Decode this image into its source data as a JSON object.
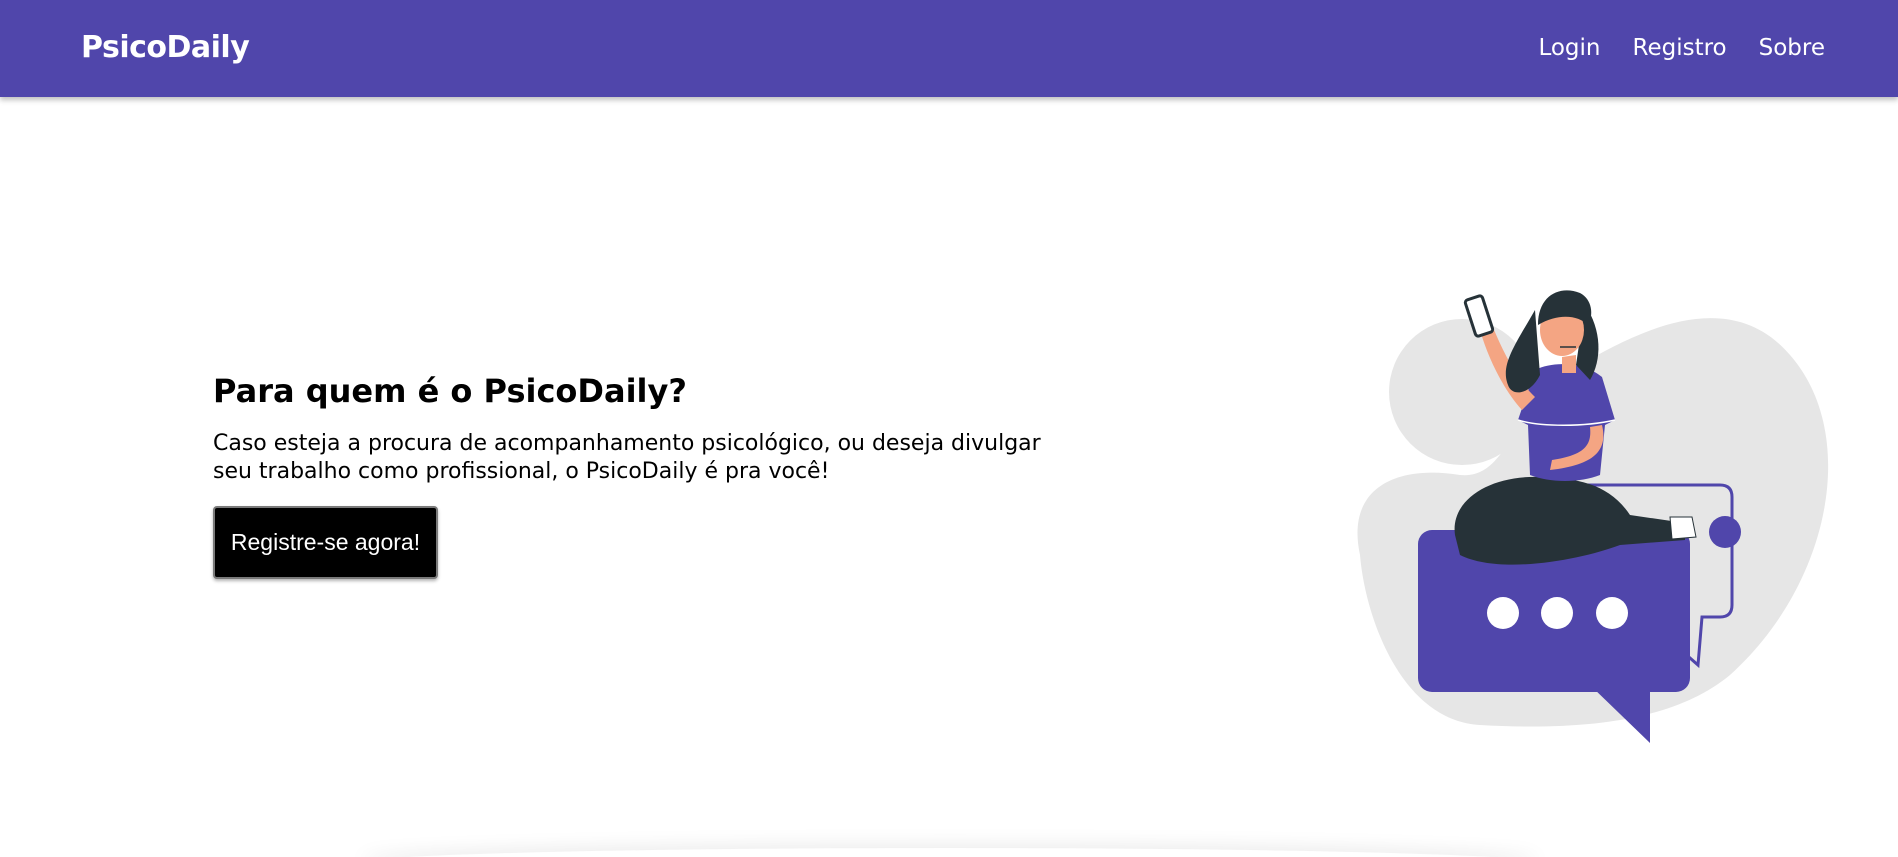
{
  "navbar": {
    "brand": "PsicoDaily",
    "links": [
      "Login",
      "Registro",
      "Sobre"
    ]
  },
  "hero": {
    "title": "Para quem é o PsicoDaily?",
    "description": "Caso esteja a procura de acompanhamento psicológico, ou deseja divulgar seu trabalho como profissional, o PsicoDaily é pra você!",
    "cta_label": "Registre-se agora!"
  },
  "colors": {
    "brand": "#5046ab",
    "background": "#ffffff",
    "cta_background": "#000000",
    "blob": "#e6e6e6"
  },
  "illustration": {
    "icon": "woman-on-chat-bubble-illustration"
  }
}
